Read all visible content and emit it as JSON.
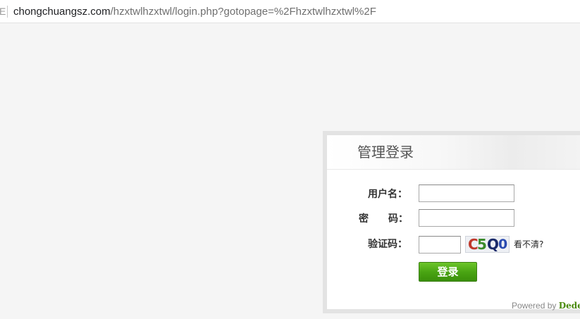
{
  "browser": {
    "address_prefix": "E",
    "url_domain": "chongchuangsz.com",
    "url_path": "/hzxtwlhzxtwl/login.php?gotopage=%2Fhzxtwlhzxtwl%2F"
  },
  "login": {
    "title": "管理登录",
    "username_label": "用户名：",
    "username_value": "",
    "password_label": "密　　码：",
    "password_value": "",
    "captcha_label": "验证码：",
    "captcha_value": "",
    "captcha_chars": [
      "C",
      "5",
      "Q",
      "0"
    ],
    "refresh_link": "看不清?",
    "submit_label": "登录",
    "powered_prefix": "Powered by ",
    "powered_brand": "DedeCMS"
  },
  "colors": {
    "button_green": "#4aa513",
    "brand_green": "#4a8a0e",
    "captcha_c": "#c0392b",
    "captcha_5": "#3a8a2a",
    "captcha_q": "#1a2a6a",
    "captcha_0": "#2a4ab0"
  }
}
